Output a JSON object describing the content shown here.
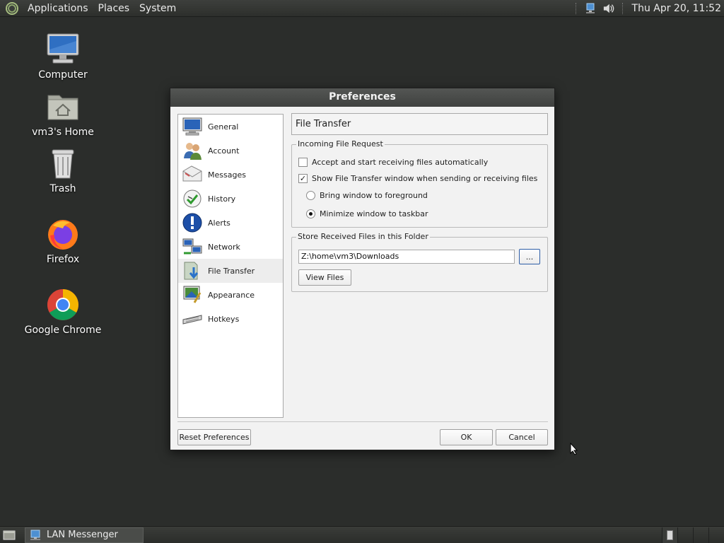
{
  "top_panel": {
    "menus": [
      "Applications",
      "Places",
      "System"
    ],
    "clock": "Thu Apr 20, 11:52",
    "tray_icons": [
      "network-icon",
      "volume-icon"
    ]
  },
  "desktop": {
    "icons": [
      {
        "label": "Computer",
        "icon": "computer-icon"
      },
      {
        "label": "vm3's Home",
        "icon": "home-folder-icon"
      },
      {
        "label": "Trash",
        "icon": "trash-icon"
      },
      {
        "label": "Firefox",
        "icon": "firefox-icon"
      },
      {
        "label": "Google Chrome",
        "icon": "chrome-icon"
      }
    ]
  },
  "dialog": {
    "title": "Preferences",
    "nav": [
      {
        "label": "General",
        "icon": "monitor-icon"
      },
      {
        "label": "Account",
        "icon": "users-icon"
      },
      {
        "label": "Messages",
        "icon": "envelope-icon"
      },
      {
        "label": "History",
        "icon": "clock-icon"
      },
      {
        "label": "Alerts",
        "icon": "info-icon"
      },
      {
        "label": "Network",
        "icon": "network-computers-icon"
      },
      {
        "label": "File Transfer",
        "icon": "file-transfer-icon"
      },
      {
        "label": "Appearance",
        "icon": "appearance-icon"
      },
      {
        "label": "Hotkeys",
        "icon": "keyboard-icon"
      }
    ],
    "selected_nav": "File Transfer",
    "page_title": "File Transfer",
    "incoming_group": {
      "legend": "Incoming File Request",
      "accept_auto": {
        "label": "Accept and start receiving files automatically",
        "checked": false
      },
      "show_window": {
        "label": "Show File Transfer window when sending or receiving files",
        "checked": true
      },
      "bring_foreground": {
        "label": "Bring window to foreground",
        "selected": false
      },
      "minimize_taskbar": {
        "label": "Minimize window to taskbar",
        "selected": true
      }
    },
    "folder_group": {
      "legend": "Store Received Files in this Folder",
      "path": "Z:\\home\\vm3\\Downloads",
      "browse_label": "...",
      "view_files_label": "View Files"
    },
    "reset_label": "Reset Preferences",
    "ok_label": "OK",
    "cancel_label": "Cancel"
  },
  "taskbar": {
    "tasks": [
      {
        "label": "LAN Messenger"
      }
    ]
  }
}
